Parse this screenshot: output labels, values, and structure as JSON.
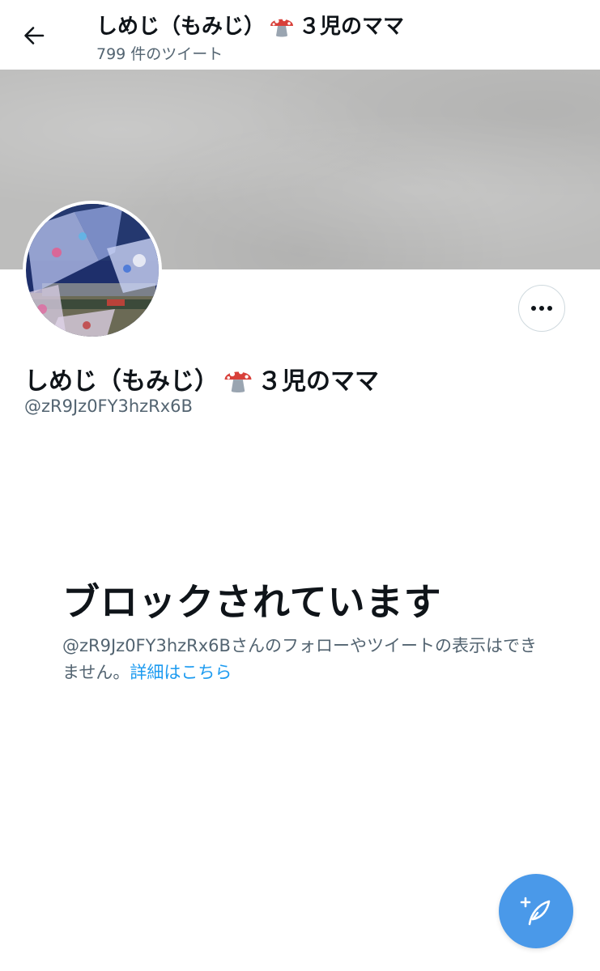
{
  "header": {
    "display_name": "しめじ（もみじ）",
    "name_suffix": "３児のママ",
    "tweet_count": "799 件のツイート",
    "back_icon": "arrow-left-icon"
  },
  "profile": {
    "display_name": "しめじ（もみじ）",
    "name_suffix": "３児のママ",
    "name_emoji": "mushroom-icon",
    "handle": "@zR9Jz0FY3hzRx6B",
    "more_icon": "ellipsis-icon"
  },
  "blocked": {
    "title": "ブロックされています",
    "message": "@zR9Jz0FY3hzRx6Bさんのフォローやツイートの表示はできません。",
    "link_text": "詳細はこちら"
  },
  "fab": {
    "icon": "compose-tweet-icon"
  },
  "colors": {
    "accent": "#1d9bf0",
    "fab": "#4a99e9",
    "text_primary": "#0f1419",
    "text_secondary": "#536471",
    "banner": "#bdbdbc"
  }
}
